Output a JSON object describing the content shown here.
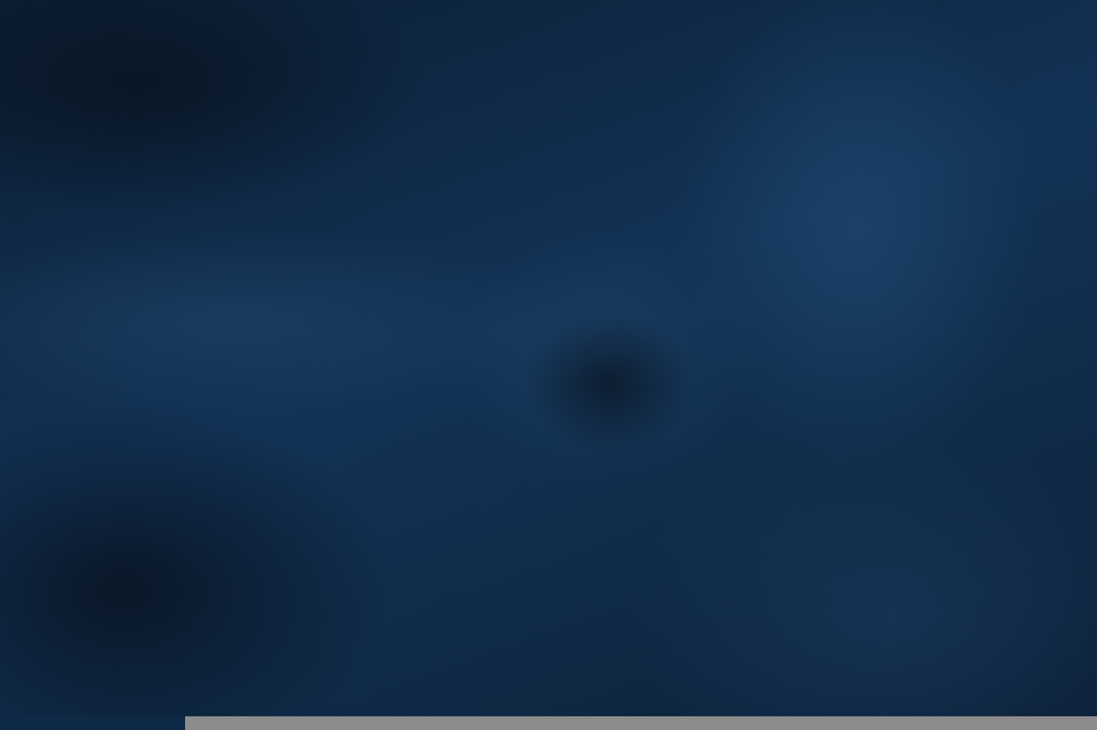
{
  "image": {
    "colors": {
      "fabric_base": "#0f2a46",
      "shadow": "#0b1e33",
      "highlight": "#1e466e",
      "bottom_strip": "#8c8c8c"
    }
  }
}
